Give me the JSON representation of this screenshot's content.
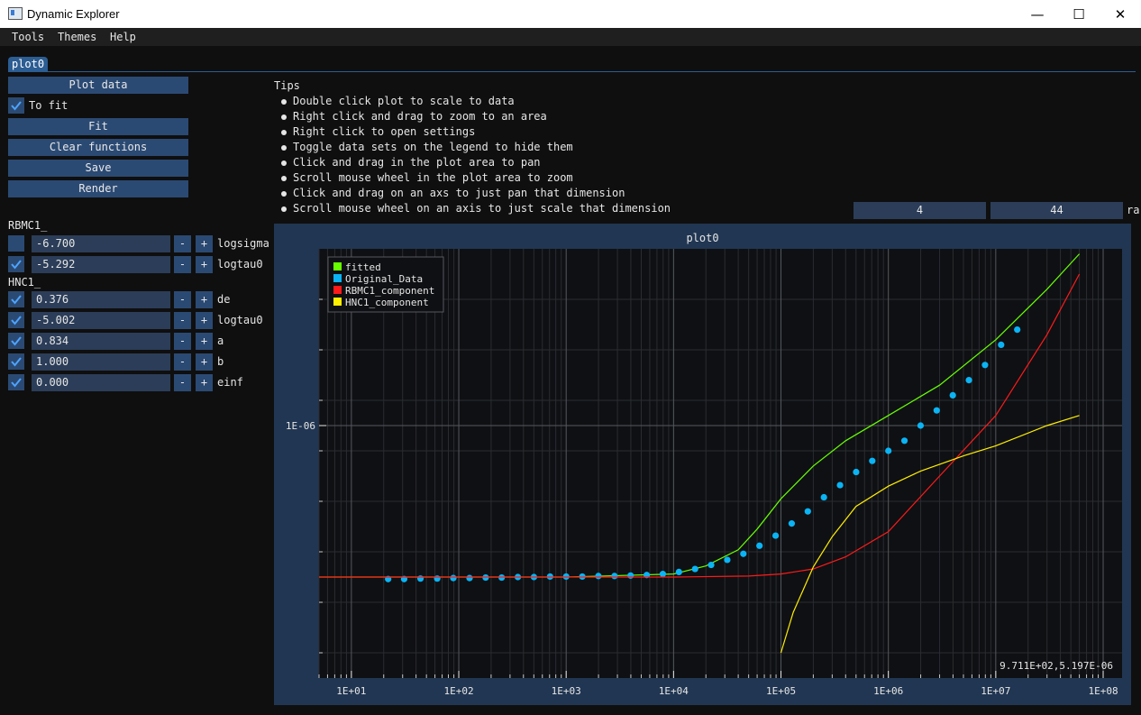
{
  "window": {
    "title": "Dynamic Explorer",
    "minimize": "—",
    "maximize": "☐",
    "close": "✕"
  },
  "menu": [
    "Tools",
    "Themes",
    "Help"
  ],
  "tab": {
    "label": "plot0"
  },
  "buttons": {
    "plot_data": "Plot data",
    "to_fit": "To fit",
    "fit": "Fit",
    "clear": "Clear functions",
    "save": "Save",
    "render": "Render"
  },
  "groups": {
    "rbmc": "RBMC1_",
    "hnc": "HNC1_"
  },
  "params": [
    {
      "checked": false,
      "value": "-6.700",
      "name": "logsigma"
    },
    {
      "checked": true,
      "value": "-5.292",
      "name": "logtau0"
    },
    {
      "checked": true,
      "value": "0.376",
      "name": "de"
    },
    {
      "checked": true,
      "value": "-5.002",
      "name": "logtau0"
    },
    {
      "checked": true,
      "value": "0.834",
      "name": "a"
    },
    {
      "checked": true,
      "value": "1.000",
      "name": "b"
    },
    {
      "checked": true,
      "value": "0.000",
      "name": "einf"
    }
  ],
  "stepper": {
    "minus": "-",
    "plus": "+"
  },
  "tips": {
    "title": "Tips",
    "items": [
      "Double click plot to scale to data",
      "Right click and drag to zoom to an area",
      "Right click to open settings",
      "Toggle data sets on the legend to hide them",
      "Click and drag in the plot area to pan",
      "Scroll mouse wheel in the plot area to zoom",
      "Click and drag on an axs to just pan that dimension",
      "Scroll mouse wheel on an axis to just scale that dimension"
    ]
  },
  "inputs": {
    "a": "4",
    "b": "44",
    "cut_label": "ra"
  },
  "colors": {
    "fitted": "#66ff00",
    "data": "#0ab4f5",
    "rbmc": "#ff1a1a",
    "hnc": "#ffee00"
  },
  "chart_data": {
    "type": "line",
    "title": "plot0",
    "xscale": "log",
    "yscale": "log",
    "xlim": [
      5,
      150000000
    ],
    "x_ticks": [
      "1E+01",
      "1E+02",
      "1E+03",
      "1E+04",
      "1E+05",
      "1E+06",
      "1E+07",
      "1E+08"
    ],
    "y_ticks": [
      "1E-06"
    ],
    "legend_position": "top-left",
    "coord_readout": "9.711E+02,5.197E-06",
    "series": [
      {
        "name": "fitted",
        "x": [
          3,
          100,
          1000,
          10000,
          20000,
          40000,
          60000,
          100000,
          200000,
          400000,
          1000000,
          3000000,
          10000000,
          30000000,
          60000000
        ],
        "y": [
          0.7,
          0.7,
          0.7,
          0.706,
          0.722,
          0.754,
          0.795,
          0.855,
          0.92,
          0.97,
          1.02,
          1.08,
          1.17,
          1.27,
          1.34
        ]
      },
      {
        "name": "Original_Data",
        "x": [
          22,
          31,
          44,
          63,
          89,
          126,
          178,
          251,
          355,
          501,
          708,
          1000,
          1413,
          1995,
          2818,
          3981,
          5623,
          7943,
          11220,
          15849,
          22387,
          31623,
          44668,
          63096,
          89125,
          125893,
          177828,
          251189,
          354813,
          501187,
          707946,
          1000000,
          1412538,
          1995262,
          2818383,
          3981072,
          5623413,
          7943282,
          11220185,
          15848932
        ],
        "y": [
          0.696,
          0.696,
          0.697,
          0.697,
          0.698,
          0.698,
          0.699,
          0.699,
          0.7,
          0.7,
          0.701,
          0.701,
          0.701,
          0.702,
          0.702,
          0.703,
          0.704,
          0.706,
          0.71,
          0.716,
          0.724,
          0.734,
          0.746,
          0.762,
          0.782,
          0.806,
          0.83,
          0.858,
          0.882,
          0.908,
          0.93,
          0.95,
          0.97,
          1.0,
          1.03,
          1.06,
          1.09,
          1.12,
          1.16,
          1.19
        ]
      },
      {
        "name": "RBMC1_component",
        "x": [
          3,
          100,
          1000,
          10000,
          50000,
          100000,
          200000,
          400000,
          1000000,
          3000000,
          10000000,
          30000000,
          60000000
        ],
        "y": [
          0.7,
          0.7,
          0.7,
          0.7,
          0.702,
          0.706,
          0.716,
          0.74,
          0.79,
          0.9,
          1.02,
          1.18,
          1.3
        ]
      },
      {
        "name": "HNC1_component",
        "x": [
          100000,
          130000,
          200000,
          300000,
          500000,
          1000000,
          2000000,
          5000000,
          10000000,
          30000000,
          60000000
        ],
        "y": [
          0.55,
          0.63,
          0.72,
          0.78,
          0.84,
          0.88,
          0.91,
          0.94,
          0.96,
          1.0,
          1.02
        ]
      }
    ]
  }
}
